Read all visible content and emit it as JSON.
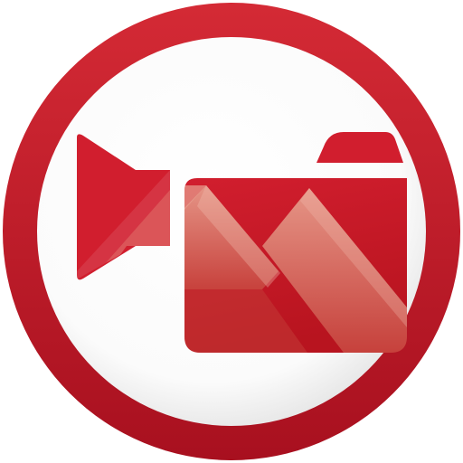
{
  "icon": {
    "name": "video-camera-app-icon",
    "glyph": "video-camera-icon",
    "colors": {
      "ring_outer": "#a8101f",
      "ring_inner": "#d42a35",
      "face_light": "#ffffff",
      "face_shadow": "#e6e6e6",
      "camera_red": "#d11e2e",
      "camera_dark": "#b5121f",
      "mountain_highlight": "#e69a8c"
    }
  }
}
